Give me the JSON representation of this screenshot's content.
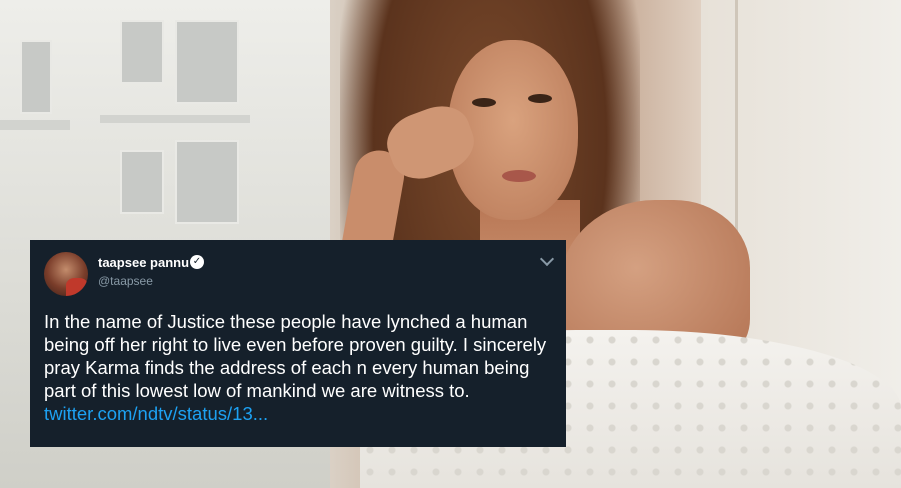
{
  "tweet": {
    "display_name": "taapsee pannu",
    "handle": "@taapsee",
    "text": "In the name of Justice these people have lynched a human being off her right to live even before proven guilty. I sincerely pray Karma finds the address of each n every human being part of this lowest low of mankind we are witness to. ",
    "link_text": "twitter.com/ndtv/status/13...",
    "verified_icon": "verified-badge-icon",
    "menu_icon": "chevron-down-icon"
  },
  "colors": {
    "tweet_bg": "#15202b",
    "link": "#1da1f2",
    "handle": "#8899a6"
  }
}
